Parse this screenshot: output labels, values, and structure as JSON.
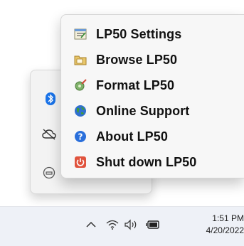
{
  "context_menu": {
    "items": [
      {
        "label": "LP50 Settings",
        "icon": "settings-icon"
      },
      {
        "label": "Browse LP50",
        "icon": "folder-icon"
      },
      {
        "label": "Format LP50",
        "icon": "format-icon"
      },
      {
        "label": "Online Support",
        "icon": "globe-icon"
      },
      {
        "label": "About LP50",
        "icon": "help-icon"
      },
      {
        "label": "Shut down LP50",
        "icon": "power-icon"
      }
    ]
  },
  "tray_overflow": {
    "icons": [
      "bluetooth-icon",
      "cloud-offline-icon",
      "usb-drive-icon"
    ]
  },
  "taskbar": {
    "icons": [
      "chevron-up-icon",
      "wifi-icon",
      "volume-icon",
      "battery-icon"
    ],
    "time": "1:51 PM",
    "date": "4/20/2022"
  },
  "colors": {
    "menu_bg": "#f7f7f7",
    "taskbar_bg": "#eef1f7",
    "bluetooth_blue": "#1a73e8",
    "power_red": "#e0533d",
    "help_blue": "#2a6fdb"
  }
}
